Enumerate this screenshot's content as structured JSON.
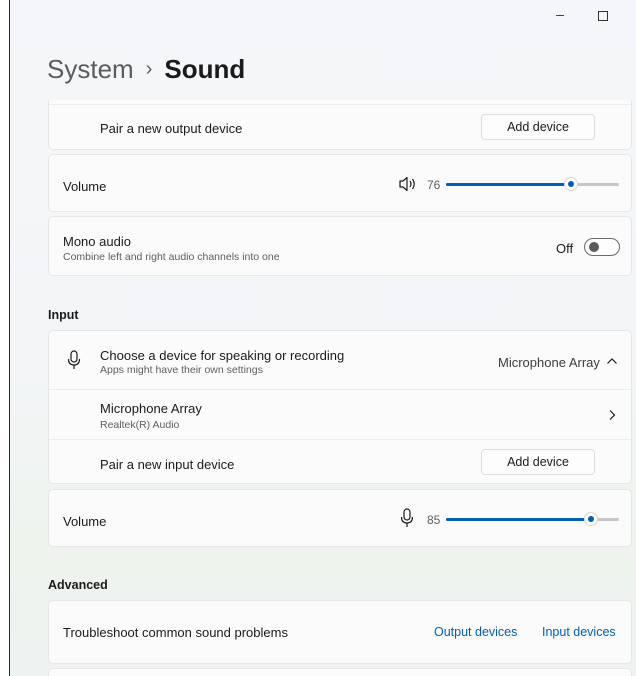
{
  "window": {
    "minimize": "–",
    "maximize": "□",
    "close": "×"
  },
  "breadcrumb": {
    "parent": "System",
    "separator": "›",
    "current": "Sound"
  },
  "output": {
    "pair_label": "Pair a new output device",
    "add_button": "Add device",
    "volume_label": "Volume",
    "volume_value": "76",
    "volume_level": 76
  },
  "mono": {
    "title": "Mono audio",
    "subtitle": "Combine left and right audio channels into one",
    "state": "Off"
  },
  "input": {
    "section": "Input",
    "choose_title": "Choose a device for speaking or recording",
    "choose_subtitle": "Apps might have their own settings",
    "selected_device": "Microphone Array",
    "device_name": "Microphone Array",
    "device_driver": "Realtek(R) Audio",
    "pair_label": "Pair a new input device",
    "add_button": "Add device",
    "volume_label": "Volume",
    "volume_value": "85",
    "volume_level": 85
  },
  "advanced": {
    "section": "Advanced",
    "troubleshoot": "Troubleshoot common sound problems",
    "output_link": "Output devices",
    "input_link": "Input devices"
  },
  "icons": {
    "speaker": "speaker-icon",
    "microphone": "microphone-icon",
    "chevron_up": "chevron-up-icon",
    "chevron_right": "chevron-right-icon"
  },
  "colors": {
    "accent": "#005fb8"
  }
}
